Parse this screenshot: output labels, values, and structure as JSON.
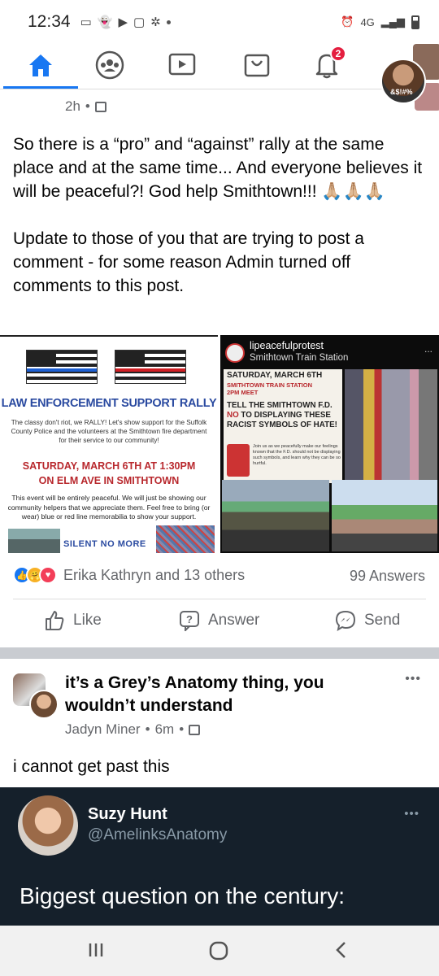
{
  "status_bar": {
    "time": "12:34",
    "network": "4G"
  },
  "nav": {
    "tabs": [
      "home-icon",
      "groups-icon",
      "watch-icon",
      "marketplace-icon",
      "notifications-icon"
    ],
    "notification_badge": "2",
    "avatar_text": "&$!#%"
  },
  "post1": {
    "time": "2h",
    "text": "So there is a “pro” and “against” rally at the same place and at the same time... And everyone believes it will be peaceful?! God help Smithtown!!! 🙏🏼🙏🏼🙏🏼\n\nUpdate to those of you that are trying to post a comment - for some reason Admin turned off comments to this post.",
    "image_left": {
      "title": "LAW ENFORCEMENT SUPPORT RALLY",
      "body": "The classy don't riot, we RALLY! Let's show support for the Suffolk County Police and the volunteers at the Smithtown fire department for their service to our community!",
      "date_line1": "SATURDAY, MARCH 6TH AT 1:30PM",
      "date_line2": "ON ELM AVE IN SMITHTOWN",
      "body2": "This event will be entirely peaceful. We will just be showing our community helpers that we appreciate them. Feel free to bring (or wear) blue or red line memorabilia to show your support.",
      "footer": "SILENT NO MORE"
    },
    "image_right": {
      "account": "lipeacefulprotest",
      "location": "Smithtown Train Station",
      "dots": "...",
      "flyer_l1": "SATURDAY, MARCH 6TH",
      "flyer_l2": "SMITHTOWN TRAIN STATION",
      "flyer_l3": "2PM MEET",
      "flyer_big1": "TELL THE SMITHTOWN F.D.",
      "flyer_no": "NO",
      "flyer_big2": " TO DISPLAYING THESE RACIST SYMBOLS OF HATE!",
      "flyer_small": "Join us as we peacefully make our feelings known that the F.D. should not be displaying such symbols, and learn why they can be so hurtful."
    },
    "reactions_names": "Erika Kathryn and 13 others",
    "answers_count": "99 Answers",
    "actions": {
      "like": "Like",
      "answer": "Answer",
      "send": "Send"
    }
  },
  "post2": {
    "group_title": "it’s a Grey’s Anatomy thing, you wouldn’t understand",
    "author": "Jadyn Miner",
    "time": "6m",
    "text": "i cannot get past this",
    "dots": "•••",
    "tweet": {
      "name": "Suzy Hunt",
      "handle": "@AmelinksAnatomy",
      "dots": "•••",
      "text": "Biggest question on the century:"
    }
  }
}
